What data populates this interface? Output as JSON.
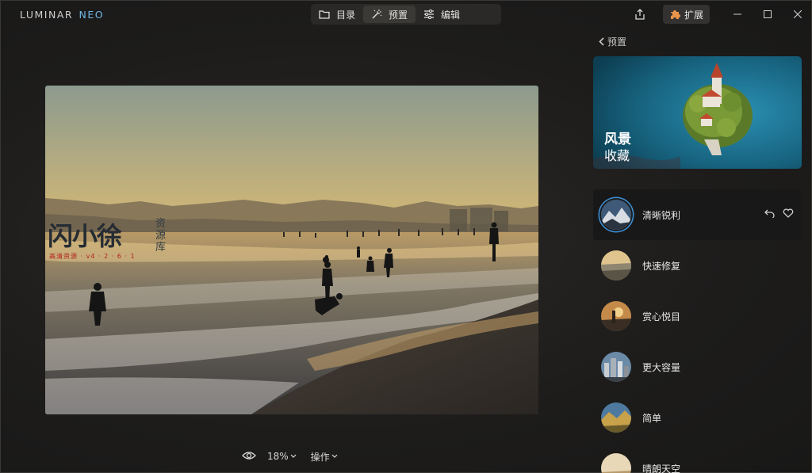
{
  "app": {
    "logo_main": "LUMINAR",
    "logo_accent": "NEO",
    "accent_color": "#6fb7e6",
    "selection_color": "#3c8fd6"
  },
  "modes": [
    {
      "label": "目录",
      "icon": "folder-icon"
    },
    {
      "label": "预置",
      "icon": "magic-wand-icon",
      "active": true
    },
    {
      "label": "编辑",
      "icon": "sliders-icon"
    }
  ],
  "toolbar": {
    "share_icon": "share-icon",
    "extensions_label": "扩展",
    "extensions_icon": "puzzle-icon"
  },
  "window": {
    "minimize_icon": "minimize-icon",
    "maximize_icon": "maximize-icon",
    "close_icon": "close-icon"
  },
  "watermark": {
    "main": "闪小徐",
    "side": "资源库",
    "sub": "高清资源 · v4 · 2 · 6 · 1"
  },
  "bottom": {
    "zoom": "18%",
    "actions": "操作"
  },
  "panel": {
    "back_label": "预置",
    "banner": {
      "title": "风景",
      "subtitle": "收藏"
    },
    "carousel": {
      "count": 2,
      "active_index": 0
    },
    "presets": [
      {
        "label": "清晰锐利",
        "active": true
      },
      {
        "label": "快速修复"
      },
      {
        "label": "赏心悦目"
      },
      {
        "label": "更大容量"
      },
      {
        "label": "简单"
      },
      {
        "label": "晴朗天空"
      }
    ]
  }
}
